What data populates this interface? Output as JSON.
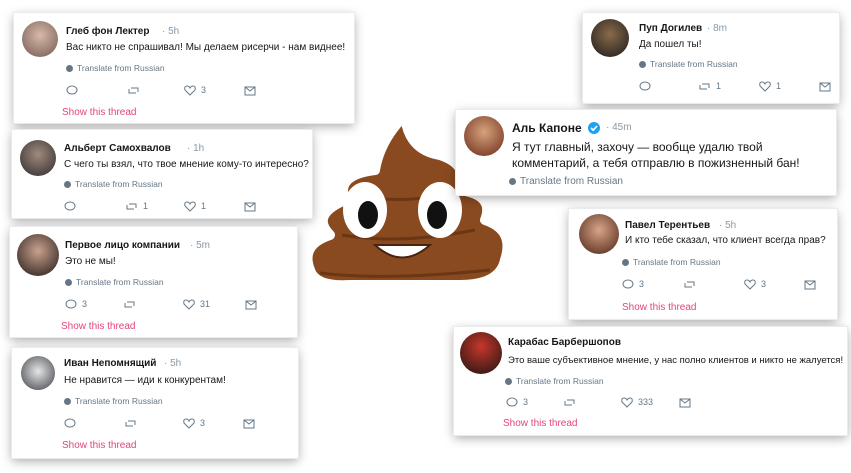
{
  "common": {
    "translate_label": "Translate from Russian",
    "show_thread_label": "Show this thread"
  },
  "tweets": [
    {
      "author": "Глеб фон Лектер",
      "time": "5h",
      "text": "Вас никто не спрашивал! Мы делаем рисерчи - нам виднее!",
      "replies": "",
      "retweets": "",
      "likes": "3"
    },
    {
      "author": "Альберт Самохвалов",
      "time": "1h",
      "text": "С чего ты взял, что твое мнение кому-то интересно?",
      "replies": "",
      "retweets": "1",
      "likes": "1"
    },
    {
      "author": "Первое лицо компании",
      "time": "5m",
      "text": "Это не мы!",
      "replies": "3",
      "retweets": "",
      "likes": "31"
    },
    {
      "author": "Иван Непомнящий",
      "time": "5h",
      "text": "Не нравится — иди к конкурентам!",
      "replies": "",
      "retweets": "",
      "likes": "3"
    },
    {
      "author": "Пуп Догилев",
      "time": "8m",
      "text": "Да пошел ты!",
      "replies": "",
      "retweets": "1",
      "likes": "1"
    },
    {
      "author": "Аль Капоне",
      "time": "45m",
      "text": "Я тут главный, захочу — вообще удалю твой комментарий, а тебя отправлю в пожизненный бан!",
      "verified": true
    },
    {
      "author": "Павел Терентьев",
      "time": "5h",
      "text": "И кто тебе сказал, что клиент всегда прав?",
      "replies": "3",
      "retweets": "",
      "likes": "3"
    },
    {
      "author": "Карабас Барбершопов",
      "time": "",
      "text": "Это ваше субъективное мнение, у нас полно клиентов и никто не жалуется!",
      "replies": "3",
      "retweets": "",
      "likes": "333"
    }
  ],
  "colors": {
    "poop": "#8a4a1f",
    "link": "#e0245e",
    "verified": "#1da1f2"
  }
}
